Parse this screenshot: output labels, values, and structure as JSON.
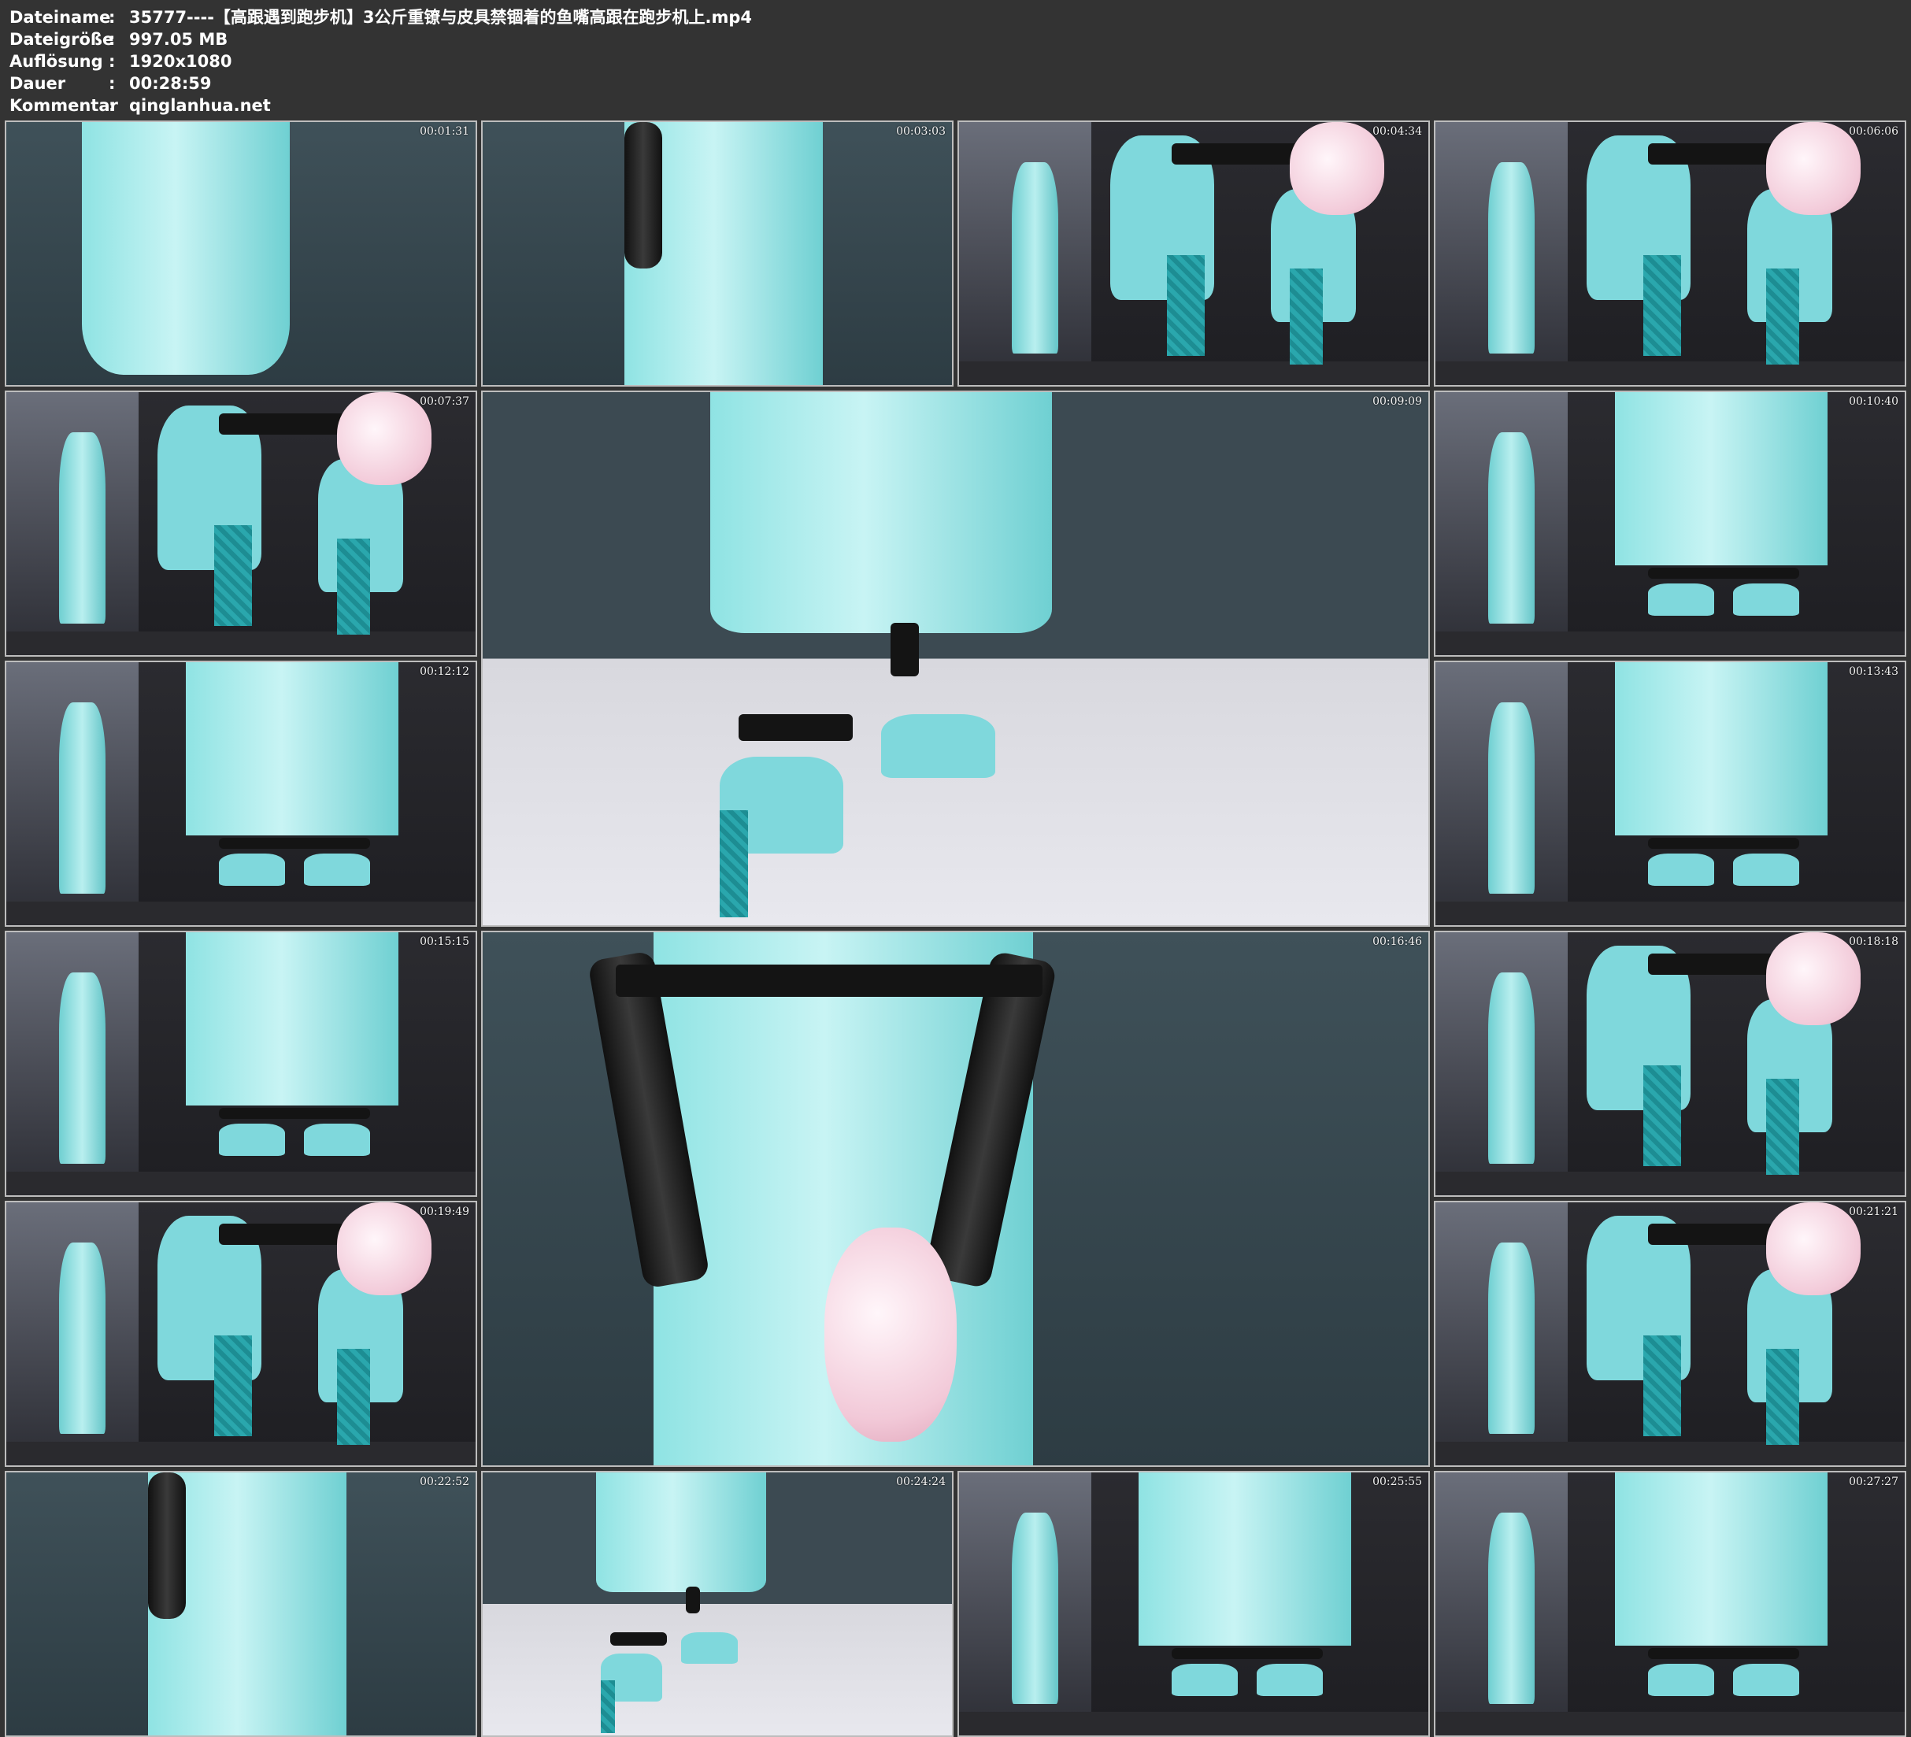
{
  "header": {
    "rows": [
      {
        "label": "Dateiname",
        "sep": ":",
        "value": "35777----【高跟遇到跑步机】3公斤重镣与皮具禁锢着的鱼嘴高跟在跑步机上.mp4"
      },
      {
        "label": "Dateigröße",
        "sep": ":",
        "value": "997.05 MB"
      },
      {
        "label": "Auflösung",
        "sep": ":",
        "value": "1920x1080"
      },
      {
        "label": "Dauer",
        "sep": ":",
        "value": "00:28:59"
      },
      {
        "label": "Kommentar",
        "sep": ":",
        "value": "qinglanhua.net"
      }
    ]
  },
  "frames": [
    {
      "time": "00:01:31",
      "scene": "dress-teal"
    },
    {
      "time": "00:03:03",
      "scene": "dress-glove"
    },
    {
      "time": "00:04:34",
      "scene": "treadmill-split-heels"
    },
    {
      "time": "00:06:06",
      "scene": "treadmill-split-heels"
    },
    {
      "time": "00:07:37",
      "scene": "treadmill-split-heels"
    },
    {
      "time": "00:09:09",
      "scene": "legs-cuffs-floor"
    },
    {
      "time": "00:10:40",
      "scene": "treadmill-split-dress"
    },
    {
      "time": "00:12:12",
      "scene": "treadmill-split-dress"
    },
    {
      "time": "00:13:43",
      "scene": "treadmill-split-dress"
    },
    {
      "time": "00:15:15",
      "scene": "treadmill-split-dress"
    },
    {
      "time": "00:16:46",
      "scene": "arms-bound-back"
    },
    {
      "time": "00:18:18",
      "scene": "treadmill-split-heels"
    },
    {
      "time": "00:19:49",
      "scene": "treadmill-split-heels"
    },
    {
      "time": "00:21:21",
      "scene": "treadmill-split-heels"
    },
    {
      "time": "00:22:52",
      "scene": "dress-glove"
    },
    {
      "time": "00:24:24",
      "scene": "legs-cuffs-floor-small"
    },
    {
      "time": "00:25:55",
      "scene": "treadmill-split-dress"
    },
    {
      "time": "00:27:27",
      "scene": "treadmill-split-dress"
    }
  ]
}
